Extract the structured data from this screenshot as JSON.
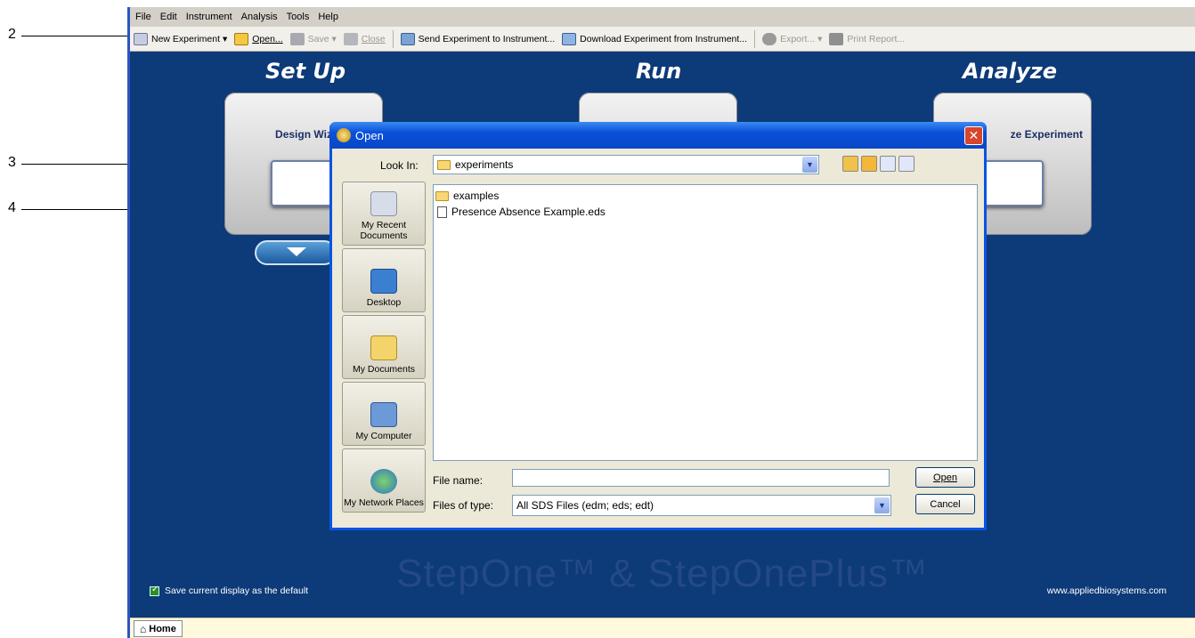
{
  "callouts": [
    "2",
    "3",
    "4"
  ],
  "menu": [
    "File",
    "Edit",
    "Instrument",
    "Analysis",
    "Tools",
    "Help"
  ],
  "toolbar": {
    "new_experiment": "New Experiment ▾",
    "open": "Open...",
    "save": "Save ▾",
    "close": "Close",
    "send": "Send Experiment to Instrument...",
    "download": "Download Experiment from Instrument...",
    "export": "Export... ▾",
    "print": "Print Report..."
  },
  "sections": {
    "setup": "Set Up",
    "run": "Run",
    "analyze": "Analyze"
  },
  "cards": {
    "design_wizard": "Design Wiz",
    "analyze_experiment": "ze Experiment"
  },
  "dialog": {
    "title": "Open",
    "look_in_label": "Look In:",
    "look_in_value": "experiments",
    "places": [
      "My Recent Documents",
      "Desktop",
      "My Documents",
      "My Computer",
      "My Network Places"
    ],
    "files": [
      {
        "name": "examples",
        "type": "folder"
      },
      {
        "name": "Presence Absence Example.eds",
        "type": "file"
      }
    ],
    "file_name_label": "File name:",
    "file_name_value": "",
    "files_of_type_label": "Files of type:",
    "files_of_type_value": "All SDS Files (edm; eds; edt)",
    "open_button": "Open",
    "cancel_button": "Cancel"
  },
  "footer": {
    "save_default": "Save current display as the default",
    "website": "www.appliedbiosystems.com",
    "watermark": "StepOne™ & StepOnePlus™",
    "home_tab": "Home"
  },
  "colors": {
    "app_background": "#0d3a78",
    "dialog_title": "#0a4fd8",
    "close_button": "#d9442a"
  }
}
